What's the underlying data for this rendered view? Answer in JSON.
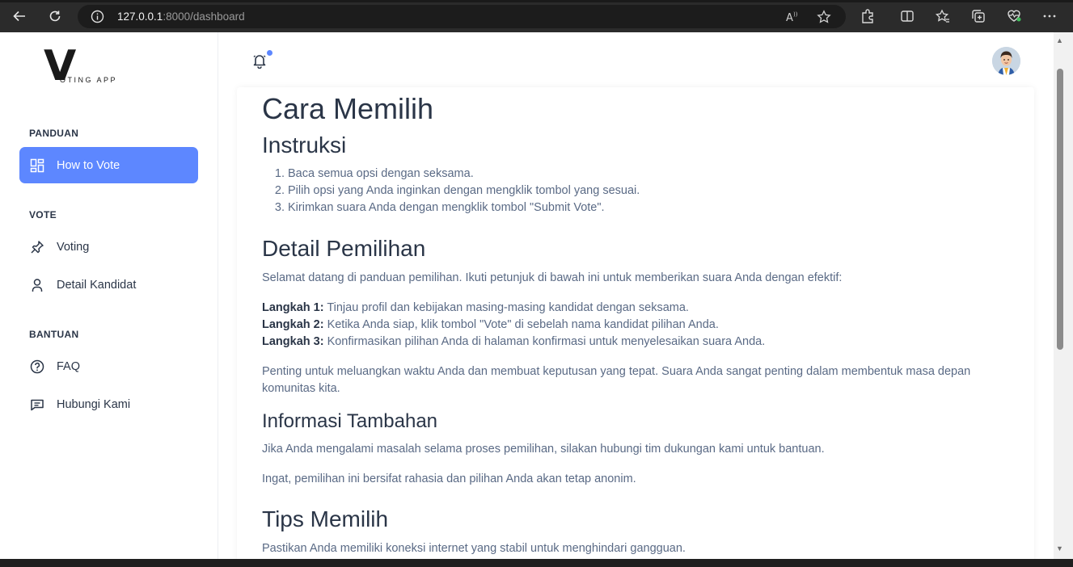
{
  "browser": {
    "url_host": "127.0.0.1",
    "url_rest": ":8000/dashboard"
  },
  "sidebar": {
    "logo_letter": "V",
    "logo_text": "OTING APP",
    "sections": [
      {
        "title": "PANDUAN",
        "items": [
          {
            "label": "How to Vote",
            "icon": "dashboard-icon",
            "active": true
          }
        ]
      },
      {
        "title": "VOTE",
        "items": [
          {
            "label": "Voting",
            "icon": "pin-icon"
          },
          {
            "label": "Detail Kandidat",
            "icon": "user-icon"
          }
        ]
      },
      {
        "title": "BANTUAN",
        "items": [
          {
            "label": "FAQ",
            "icon": "help-circle-icon"
          },
          {
            "label": "Hubungi Kami",
            "icon": "message-icon"
          }
        ]
      }
    ]
  },
  "colors": {
    "accent": "#5d87ff",
    "text": "#2a3547",
    "muted": "#5a6a85"
  },
  "content": {
    "title": "Cara Memilih",
    "instructions_heading": "Instruksi",
    "instructions": [
      "Baca semua opsi dengan seksama.",
      "Pilih opsi yang Anda inginkan dengan mengklik tombol yang sesuai.",
      "Kirimkan suara Anda dengan mengklik tombol \"Submit Vote\"."
    ],
    "detail_heading": "Detail Pemilihan",
    "detail_intro": "Selamat datang di panduan pemilihan. Ikuti petunjuk di bawah ini untuk memberikan suara Anda dengan efektif:",
    "steps": [
      {
        "label": "Langkah 1:",
        "text": " Tinjau profil dan kebijakan masing-masing kandidat dengan seksama."
      },
      {
        "label": "Langkah 2:",
        "text": " Ketika Anda siap, klik tombol \"Vote\" di sebelah nama kandidat pilihan Anda."
      },
      {
        "label": "Langkah 3:",
        "text": " Konfirmasikan pilihan Anda di halaman konfirmasi untuk menyelesaikan suara Anda."
      }
    ],
    "detail_note": "Penting untuk meluangkan waktu Anda dan membuat keputusan yang tepat. Suara Anda sangat penting dalam membentuk masa depan komunitas kita.",
    "info_heading": "Informasi Tambahan",
    "info_p1": "Jika Anda mengalami masalah selama proses pemilihan, silakan hubungi tim dukungan kami untuk bantuan.",
    "info_p2": "Ingat, pemilihan ini bersifat rahasia dan pilihan Anda akan tetap anonim.",
    "tips_heading": "Tips Memilih",
    "tips_p1": "Pastikan Anda memiliki koneksi internet yang stabil untuk menghindari gangguan."
  }
}
